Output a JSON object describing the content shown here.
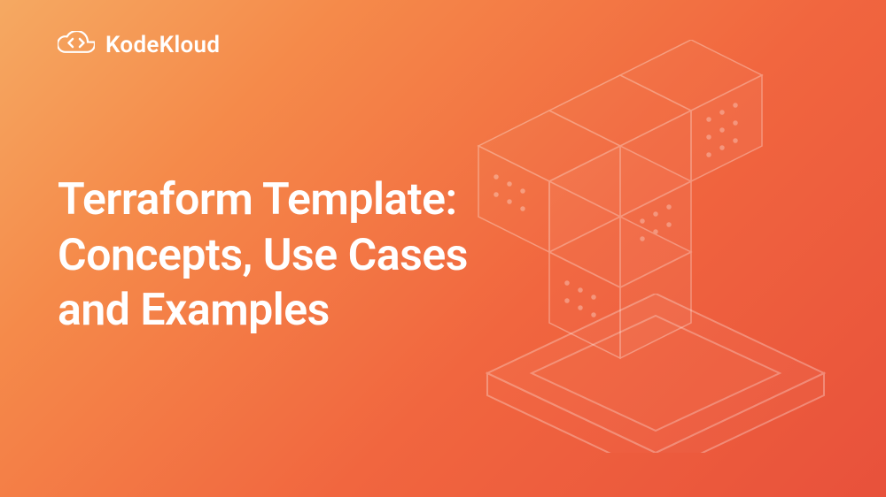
{
  "brand": {
    "name": "KodeKloud"
  },
  "title": {
    "line1": "Terraform Template:",
    "line2": "Concepts, Use Cases",
    "line3": "and Examples"
  }
}
